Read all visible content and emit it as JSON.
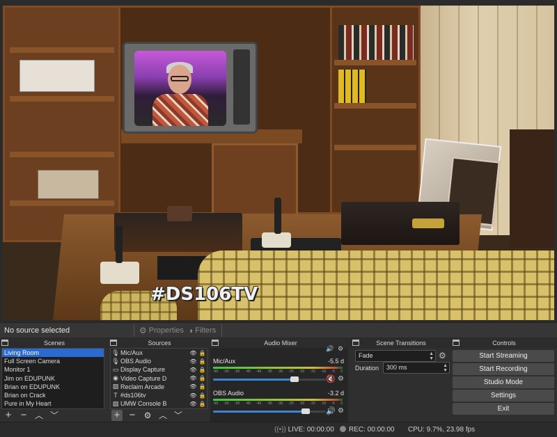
{
  "preview": {
    "watermark": "#DS106TV"
  },
  "source_toolbar": {
    "status_text": "No source selected",
    "properties_label": "Properties",
    "filters_label": "Filters"
  },
  "scenes": {
    "title": "Scenes",
    "items": [
      "Living Room",
      "Full Screen Camera",
      "Monitor 1",
      "Jim on EDUPUNK",
      "Brian on EDUPUNK",
      "Brian on Crack",
      "Pure in My Heart"
    ],
    "selected_index": 0
  },
  "sources": {
    "title": "Sources",
    "items": [
      {
        "name": "Mic/Aux",
        "icon": "microphone-icon"
      },
      {
        "name": "OBS Audio",
        "icon": "microphone-icon"
      },
      {
        "name": "Display Capture",
        "icon": "monitor-icon"
      },
      {
        "name": "Video Capture D",
        "icon": "camera-icon"
      },
      {
        "name": "Reclaim Arcade",
        "icon": "image-icon"
      },
      {
        "name": "#ds106tv",
        "icon": "text-icon"
      },
      {
        "name": "UMW Console B",
        "icon": "image-icon"
      }
    ]
  },
  "audio_mixer": {
    "title": "Audio Mixer",
    "channels": [
      {
        "name": "Mic/Aux",
        "db": "-5.5 d",
        "level": 0.96,
        "volume": 0.72,
        "muted": true
      },
      {
        "name": "OBS Audio",
        "db": "-3.2 d",
        "level": 0.97,
        "volume": 0.82,
        "muted": false
      }
    ],
    "ticks": [
      "-60",
      "-55",
      "-50",
      "-45",
      "-40",
      "-35",
      "-30",
      "-25",
      "-20",
      "-15",
      "-10",
      "-5",
      "0"
    ]
  },
  "scene_transitions": {
    "title": "Scene Transitions",
    "transition": "Fade",
    "duration_label": "Duration",
    "duration_value": "300 ms"
  },
  "controls": {
    "title": "Controls",
    "start_streaming": "Start Streaming",
    "start_recording": "Start Recording",
    "studio_mode": "Studio Mode",
    "settings": "Settings",
    "exit": "Exit"
  },
  "status_bar": {
    "live": "LIVE: 00:00:00",
    "rec": "REC: 00:00:00",
    "cpu": "CPU: 9.7%, 23.98 fps"
  },
  "colors": {
    "selection": "#2a6ad1",
    "mute_red": "#e03030",
    "volume_blue": "#3b84d6"
  }
}
